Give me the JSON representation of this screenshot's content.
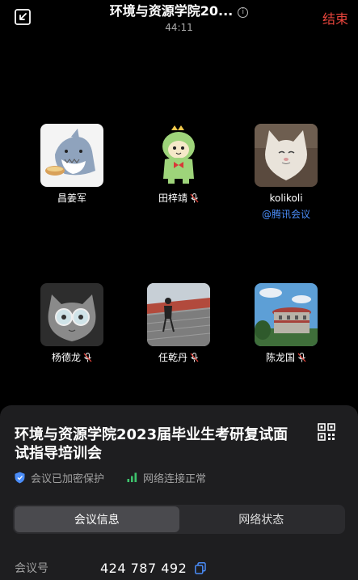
{
  "header": {
    "title": "环境与资源学院20...",
    "timer": "44:11",
    "end_label": "结束"
  },
  "participants": [
    {
      "name": "昌姜军",
      "muted": false,
      "via": ""
    },
    {
      "name": "田梓靖",
      "muted": true,
      "via": ""
    },
    {
      "name": "kolikoli",
      "muted": false,
      "via": "@腾讯会议"
    },
    {
      "name": "杨德龙",
      "muted": true,
      "via": ""
    },
    {
      "name": "任乾丹",
      "muted": true,
      "via": ""
    },
    {
      "name": "陈龙国",
      "muted": true,
      "via": ""
    }
  ],
  "sheet": {
    "title": "环境与资源学院2023届毕业生考研复试面试指导培训会",
    "encrypted_label": "会议已加密保护",
    "network_label": "网络连接正常",
    "tabs": [
      {
        "label": "会议信息",
        "active": true
      },
      {
        "label": "网络状态",
        "active": false
      }
    ],
    "meeting_id_label": "会议号",
    "meeting_id": "424 787 492"
  },
  "colors": {
    "background": "#000000",
    "sheet": "#1e1e20",
    "end": "#e8453c",
    "link": "#4a8cf7",
    "shield": "#4a8cf7",
    "signal": "#3ec46d"
  }
}
